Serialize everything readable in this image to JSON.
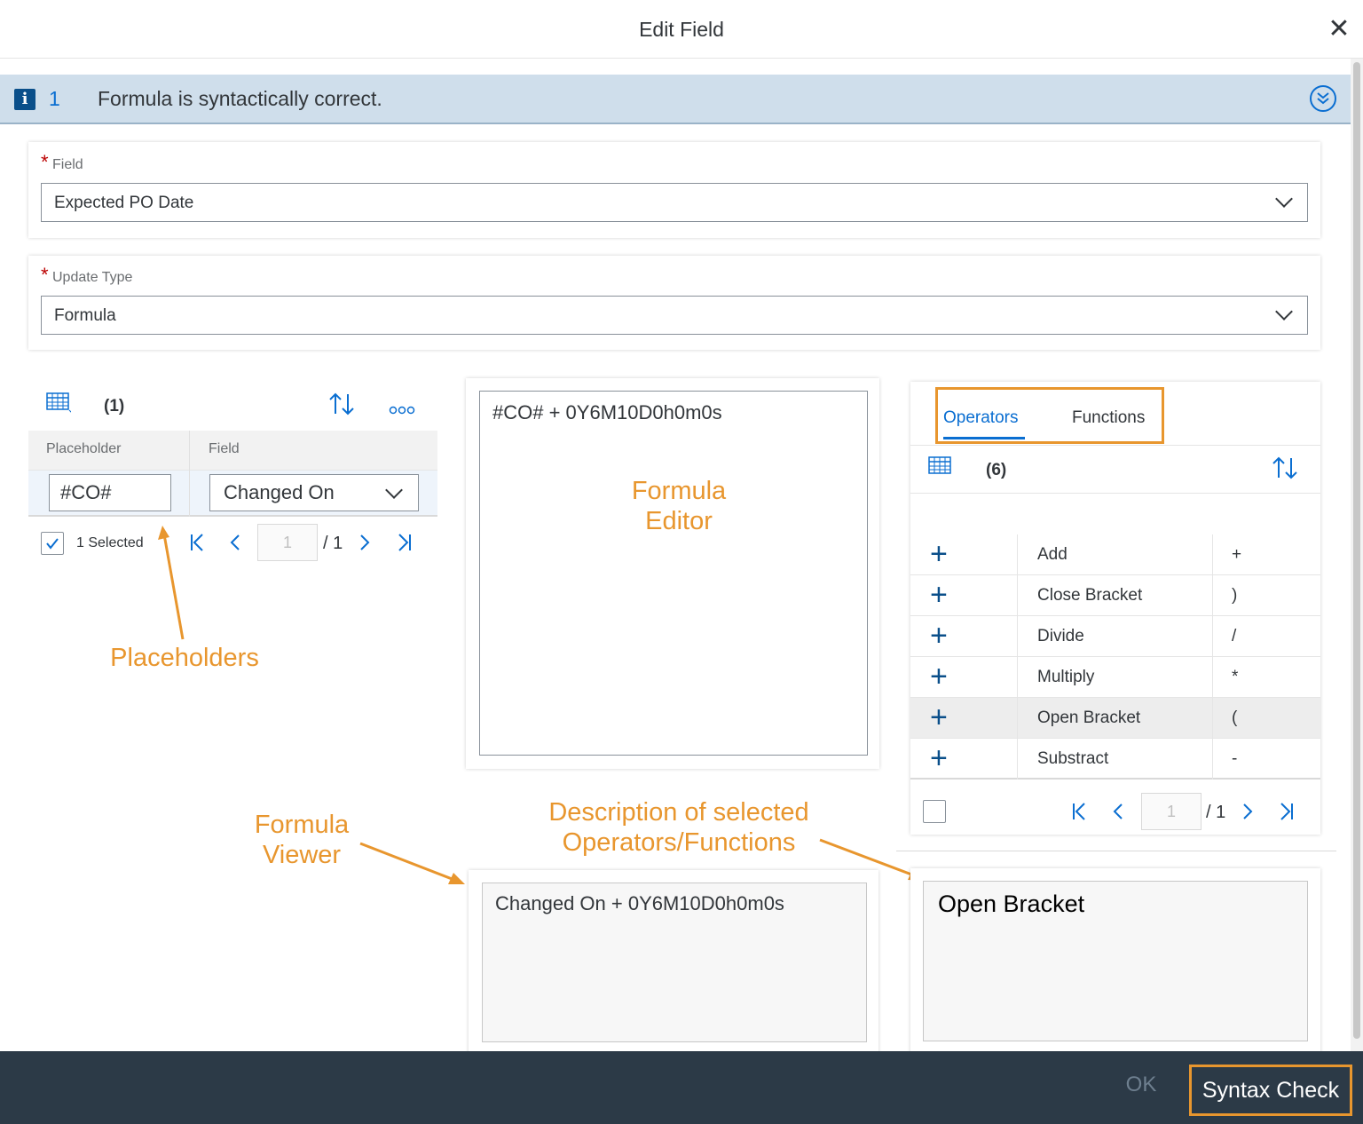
{
  "dialog": {
    "title": "Edit Field",
    "close_icon": "close-icon"
  },
  "message": {
    "icon": "info-icon",
    "count": "1",
    "text": "Formula is syntactically correct."
  },
  "field": {
    "label": "Field",
    "value": "Expected PO Date"
  },
  "update_type": {
    "label": "Update Type",
    "value": "Formula"
  },
  "placeholders": {
    "count": "(1)",
    "columns": [
      "Placeholder",
      "Field"
    ],
    "row": {
      "placeholder": "#CO#",
      "field": "Changed On"
    },
    "selected_text": "1 Selected",
    "page": "1",
    "page_total": "/ 1"
  },
  "formula_editor": {
    "text": "#CO# + 0Y6M10D0h0m0s"
  },
  "operators": {
    "tabs": [
      "Operators",
      "Functions"
    ],
    "count": "(6)",
    "rows": [
      {
        "name": "Add",
        "symbol": "+"
      },
      {
        "name": "Close Bracket",
        "symbol": ")"
      },
      {
        "name": "Divide",
        "symbol": "/"
      },
      {
        "name": "Multiply",
        "symbol": "*"
      },
      {
        "name": "Open Bracket",
        "symbol": "("
      },
      {
        "name": "Substract",
        "symbol": "-"
      }
    ],
    "page": "1",
    "page_total": "/ 1"
  },
  "formula_viewer": {
    "text": "Changed On + 0Y6M10D0h0m0s"
  },
  "description": {
    "text": "Open Bracket"
  },
  "annotations": {
    "formula_editor": [
      "Formula",
      "Editor"
    ],
    "placeholders": "Placeholders",
    "formula_viewer": [
      "Formula",
      "Viewer"
    ],
    "description": [
      "Description of selected",
      "Operators/Functions"
    ]
  },
  "footer": {
    "ok": "OK",
    "syntax_check": "Syntax Check"
  },
  "colors": {
    "accent": "#0a6ed1",
    "annotation": "#e8962e",
    "footer_bg": "#2c3a47",
    "required": "#bb0000"
  }
}
